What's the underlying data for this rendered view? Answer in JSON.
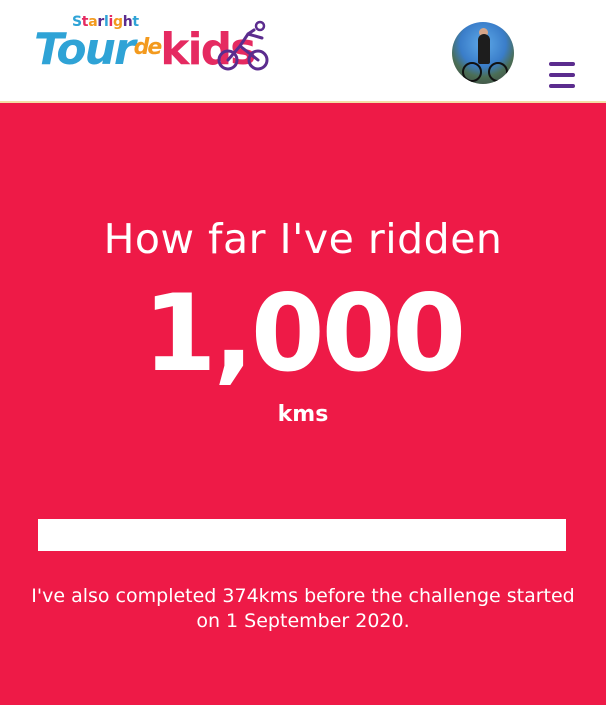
{
  "header": {
    "logo": {
      "brand": "Starlight",
      "word1": "Tour",
      "word2": "de",
      "word3": "kids"
    },
    "menu_icon": "hamburger-menu-icon",
    "avatar_icon": "profile-photo"
  },
  "hero": {
    "title": "How far I've ridden",
    "distance": "1,000",
    "unit": "kms",
    "progress": 1.0,
    "note": "I've also completed 374kms before the challenge started on 1 September 2020."
  },
  "colors": {
    "hero_background": "#ee1a47",
    "menu": "#5b2c8e",
    "logo_blue": "#2fa3d6",
    "logo_orange": "#f39a1e",
    "logo_pink": "#e52a61"
  }
}
